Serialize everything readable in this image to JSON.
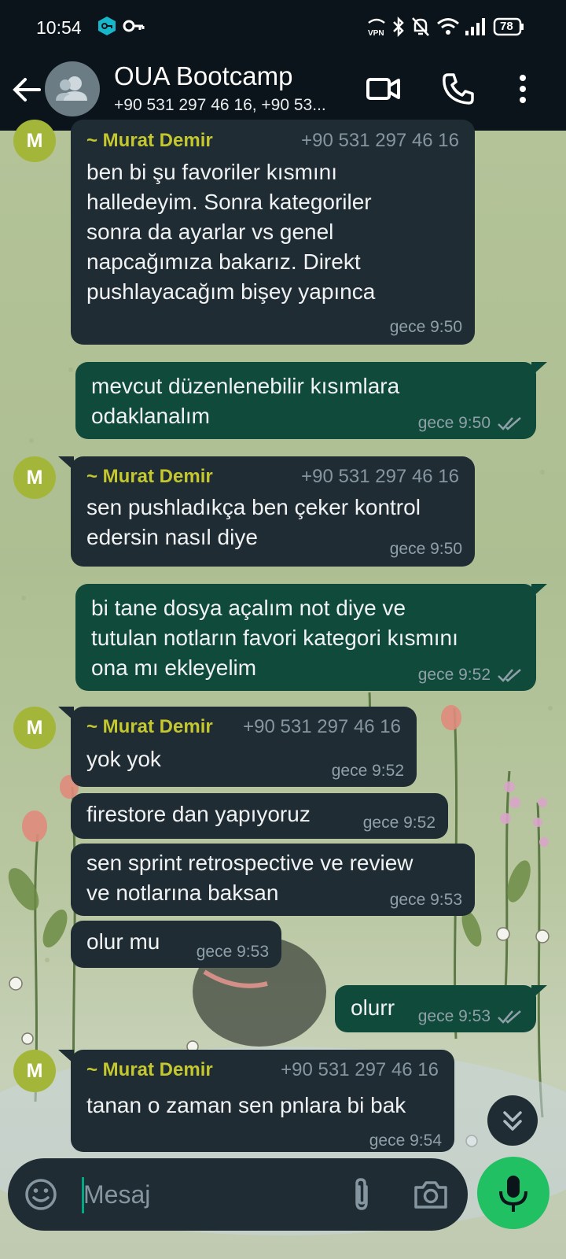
{
  "status_bar": {
    "time": "10:54",
    "battery": "78"
  },
  "header": {
    "title": "OUA Bootcamp",
    "subtitle": "+90 531 297 46 16, +90 53..."
  },
  "messages": [
    {
      "sender": "~ Murat Demir",
      "phone": "+90 531 297 46 16",
      "avatar": "M",
      "text_lines": [
        "ben bi şu favoriler kısmını",
        "halledeyim. Sonra kategoriler",
        "sonra da ayarlar vs genel",
        "napcağımıza bakarız. Direkt",
        "pushlayacağım bişey yapınca"
      ],
      "time": "gece 9:50"
    },
    {
      "text_lines": [
        "mevcut düzenlenebilir kısımlara",
        "odaklanalım"
      ],
      "time": "gece 9:50"
    },
    {
      "sender": "~ Murat Demir",
      "phone": "+90 531 297 46 16",
      "avatar": "M",
      "text_lines": [
        "sen pushladıkça ben çeker kontrol",
        "edersin nasıl diye"
      ],
      "time": "gece 9:50"
    },
    {
      "text_lines": [
        "bi tane dosya açalım not diye ve",
        "tutulan notların favori kategori kısmını",
        "ona mı ekleyelim"
      ],
      "time": "gece 9:52"
    },
    {
      "sender": "~ Murat Demir",
      "phone": "+90 531 297 46 16",
      "avatar": "M",
      "text_lines": [
        "yok yok"
      ],
      "time": "gece 9:52"
    },
    {
      "text_lines": [
        "firestore dan yapıyoruz"
      ],
      "time": "gece 9:52"
    },
    {
      "text_lines": [
        "sen sprint retrospective ve review",
        "ve notlarına baksan"
      ],
      "time": "gece 9:53"
    },
    {
      "text_lines": [
        "olur mu"
      ],
      "time": "gece 9:53"
    },
    {
      "text_lines": [
        "olurr"
      ],
      "time": "gece 9:53"
    },
    {
      "sender": "~ Murat Demir",
      "phone": "+90 531 297 46 16",
      "avatar": "M",
      "text_lines": [
        "tanan o zaman sen pnlara bi bak"
      ],
      "time": "gece 9:54"
    }
  ],
  "input": {
    "placeholder": "Mesaj"
  },
  "colors": {
    "header_bg": "#0b141a",
    "incoming_bubble": "#1f2c34",
    "outgoing_bubble": "#0f4a3b",
    "sender_name": "#c4c72e",
    "mic_button": "#21c063",
    "avatar_bg": "#a4b639"
  }
}
